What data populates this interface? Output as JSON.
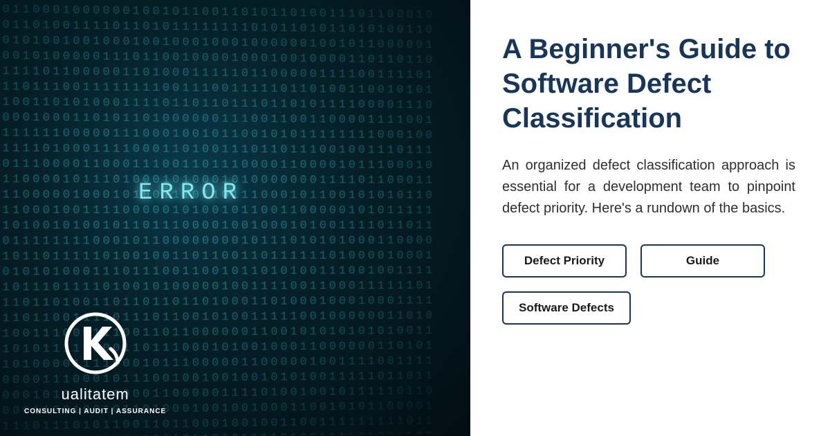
{
  "left": {
    "error_label": "ERROR",
    "logo": {
      "name": "ualitatem",
      "tagline": "CONSULTING | AUDIT | ASSURANCE"
    }
  },
  "right": {
    "title": "A Beginner's Guide to Software Defect Classification",
    "description": "An organized defect classification approach is essential for a development team to pinpoint defect priority.  Here's a rundown of the basics.",
    "tags": [
      "Defect Priority",
      "Guide",
      "Software Defects"
    ]
  }
}
